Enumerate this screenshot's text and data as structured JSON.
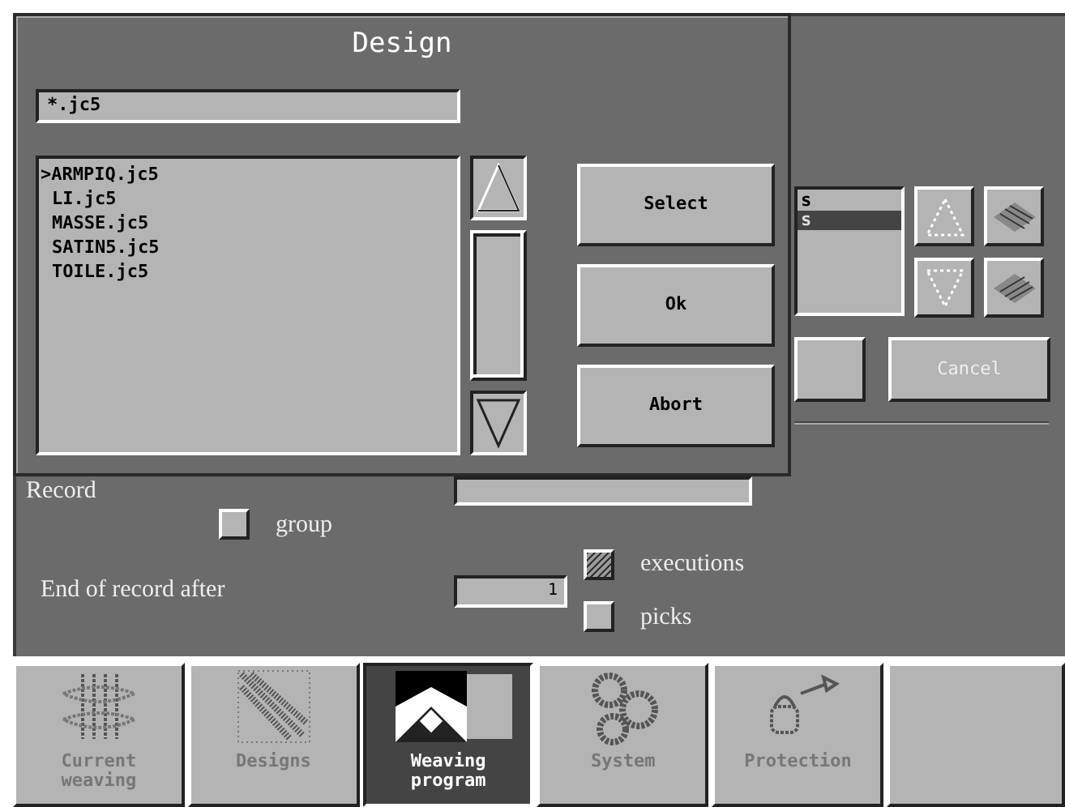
{
  "dialog": {
    "title": "Design",
    "filter": "*.jc5",
    "files": [
      ">ARMPIQ.jc5",
      "LI.jc5",
      "MASSE.jc5",
      "SATIN5.jc5",
      "TOILE.jc5"
    ],
    "buttons": [
      "Select",
      "Ok",
      "Abort"
    ]
  },
  "background": {
    "list_rows": [
      {
        "label": "s",
        "selected": false
      },
      {
        "label": "s",
        "selected": true
      }
    ],
    "buttons": [
      {
        "label": "Cancel",
        "disabled": true
      }
    ],
    "record_label": "Record",
    "group": {
      "label": "group",
      "checked": false
    },
    "end_label": "End of record after",
    "end_value": "1",
    "options": [
      {
        "label": "executions",
        "checked": true
      },
      {
        "label": "picks",
        "checked": false
      }
    ]
  },
  "taskbar": [
    {
      "label": "Current weaving",
      "kind": "weave",
      "selected": false
    },
    {
      "label": "Designs",
      "kind": "design",
      "selected": false
    },
    {
      "label": "Weaving program",
      "kind": "program",
      "selected": true
    },
    {
      "label": "System",
      "kind": "gears",
      "selected": false
    },
    {
      "label": "Protection",
      "kind": "lock",
      "selected": false
    }
  ]
}
